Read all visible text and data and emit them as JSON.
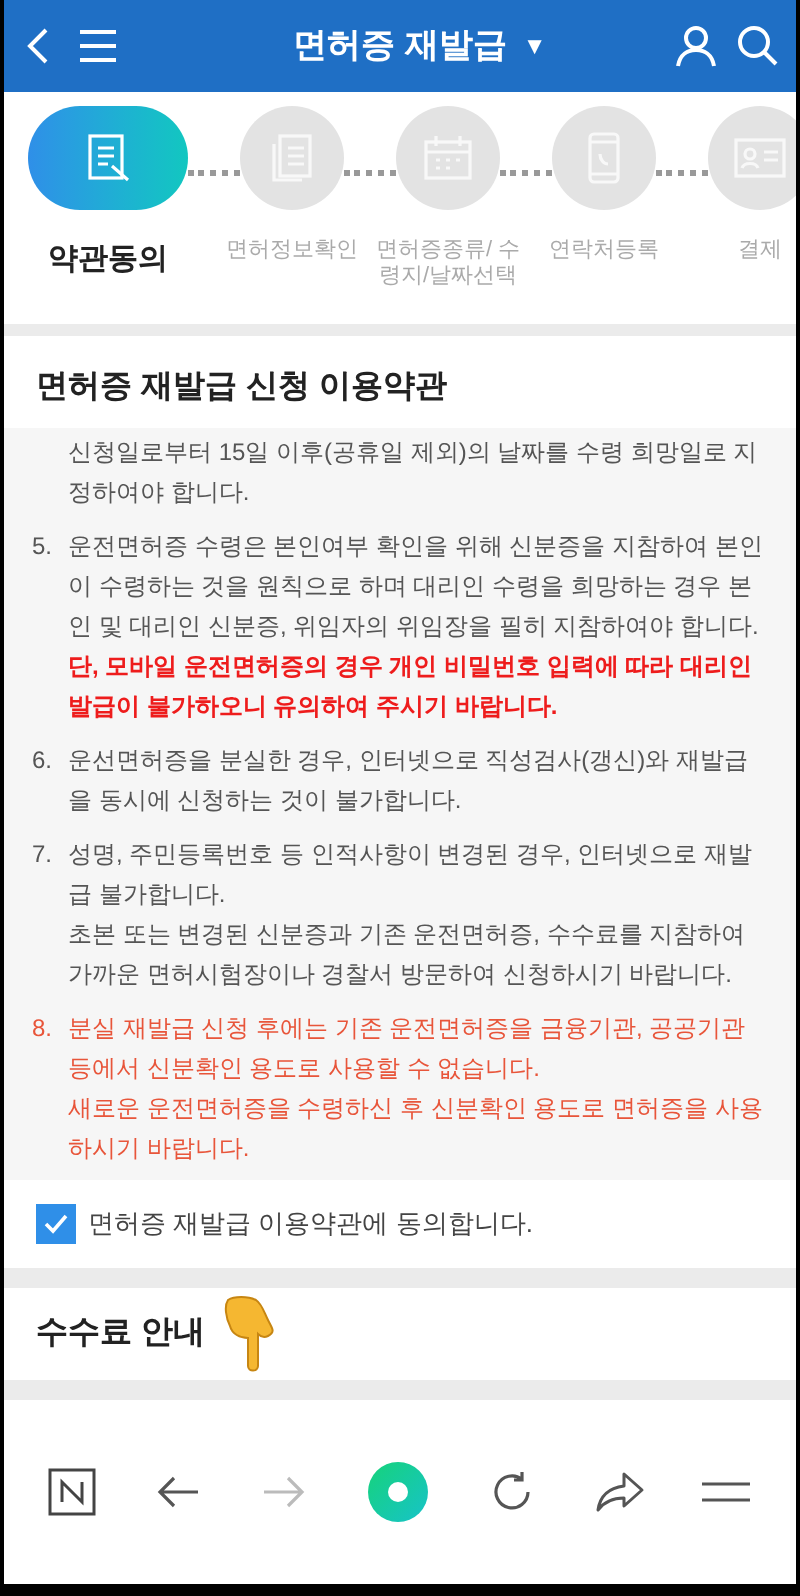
{
  "header": {
    "title": "면허증 재발급",
    "caret": "▼"
  },
  "steps": [
    {
      "kind": "document",
      "label": "약관동의",
      "selected": true
    },
    {
      "kind": "documents",
      "label": "면허정보확인",
      "selected": false
    },
    {
      "kind": "calendar",
      "label": "면허증종류/ 수령지/날짜선택",
      "selected": false
    },
    {
      "kind": "phone",
      "label": "연락처등록",
      "selected": false
    },
    {
      "kind": "idcard",
      "label": "결제",
      "selected": false
    }
  ],
  "terms": {
    "title": "면허증 재발급 신청 이용약관",
    "items": [
      {
        "warning": false,
        "lines": [
          "신청일로부터 15일 이후(공휴일 제외)의 날짜를 수령 희망일로 지정하여야 합니다."
        ]
      },
      {
        "number": "5.",
        "warning": false,
        "lines": [
          "운전면허증 수령은 본인여부 확인을 위해 신분증을 지참하여 본인이 수령하는 것을 원칙으로 하며 대리인 수령을 희망하는 경우 본인 및 대리인 신분증, 위임자의 위임장을 필히 지참하여야 합니다.  **단, 모바일 운전면허증의 경우 개인 비밀번호 입력에 따라 대리인 발급이 불가하오니 유의하여 주시기 바랍니다.**"
        ]
      },
      {
        "number": "6.",
        "warning": false,
        "lines": [
          "운선면허증을 분실한 경우, 인터넷으로 직성검사(갱신)와 재발급을 동시에 신청하는 것이 불가합니다."
        ]
      },
      {
        "number": "7.",
        "warning": false,
        "lines": [
          "성명, 주민등록번호 등 인적사항이 변경된 경우, 인터넷으로 재발급 불가합니다.",
          "초본 또는 변경된 신분증과 기존 운전면허증, 수수료를 지참하여 가까운 면허시험장이나 경찰서 방문하여 신청하시기 바랍니다."
        ]
      },
      {
        "number": "8.",
        "warning": true,
        "lines": [
          "분실 재발급 신청 후에는 기존 운전면허증을 금융기관, 공공기관 등에서 신분확인 용도로 사용할 수 없습니다.",
          "새로운 운전면허증을 수령하신 후 신분확인 용도로 면허증을 사용하시기 바랍니다."
        ]
      }
    ]
  },
  "agree": {
    "label": "면허증 재발급 이용약관에 동의합니다.",
    "checked": true
  },
  "fee": {
    "title": "수수료 안내"
  }
}
